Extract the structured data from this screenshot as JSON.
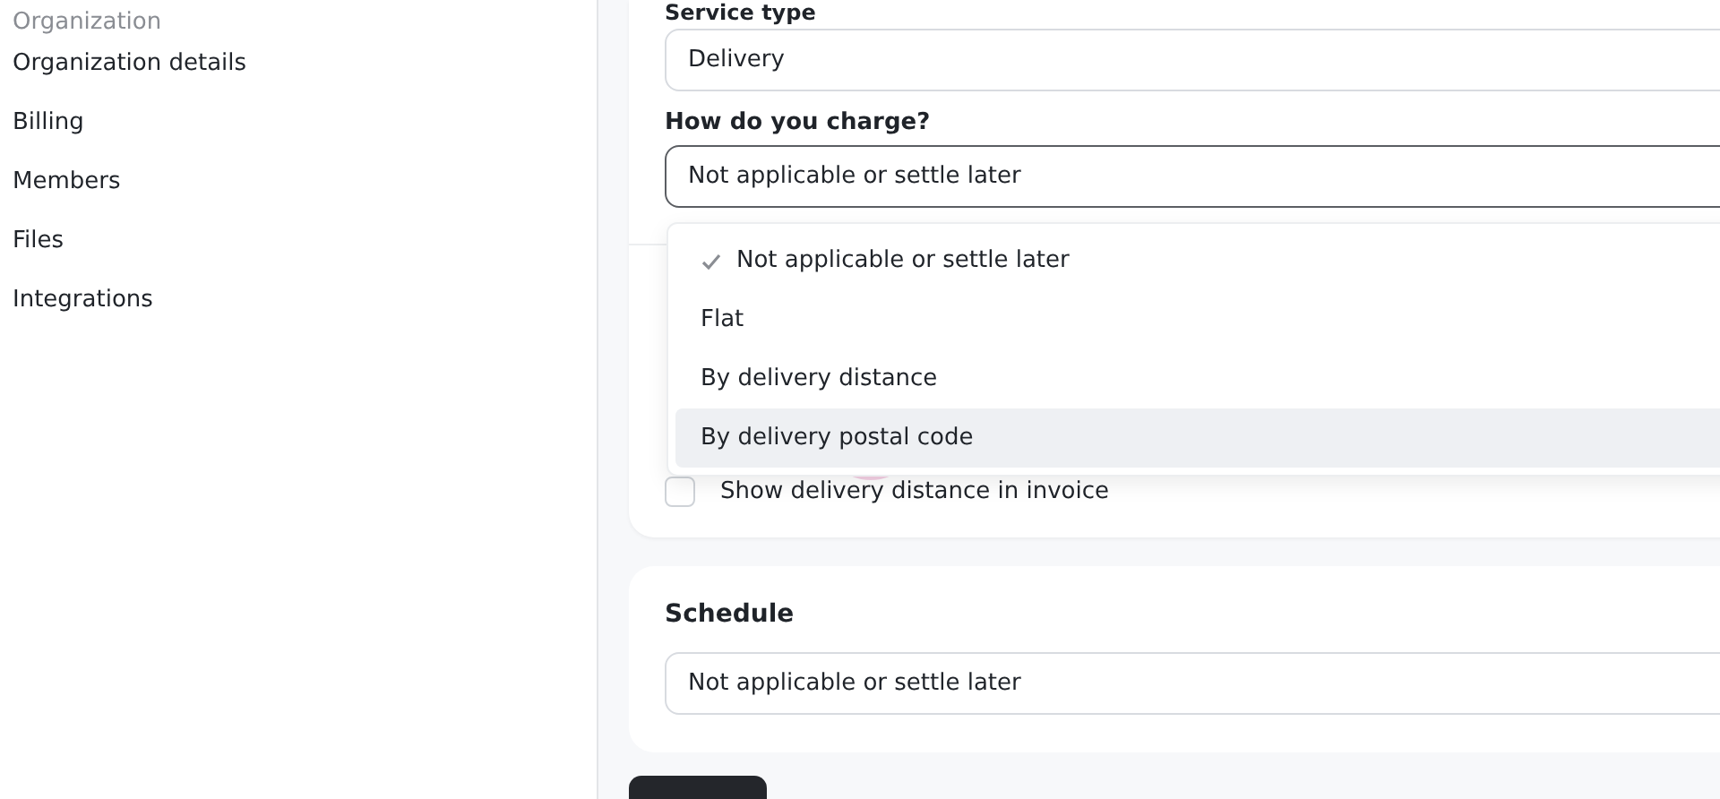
{
  "sidebar": {
    "section_label": "Organization",
    "items": [
      {
        "label": "Organization details"
      },
      {
        "label": "Billing"
      },
      {
        "label": "Members"
      },
      {
        "label": "Files"
      },
      {
        "label": "Integrations"
      }
    ]
  },
  "service_card": {
    "service_type": {
      "label": "Service type",
      "value": "Delivery"
    },
    "charge": {
      "label": "How do you charge?",
      "value": "Not applicable or settle later",
      "expanded": true,
      "options": [
        {
          "label": "Not applicable or settle later",
          "selected": true,
          "hovered": false
        },
        {
          "label": "Flat",
          "selected": false,
          "hovered": false
        },
        {
          "label": "By delivery distance",
          "selected": false,
          "hovered": false
        },
        {
          "label": "By delivery postal code",
          "selected": false,
          "hovered": true
        }
      ]
    },
    "invoice_option": {
      "label": "Show delivery distance in invoice",
      "checked": false
    }
  },
  "schedule_card": {
    "title": "Schedule",
    "value": "Not applicable or settle later"
  }
}
